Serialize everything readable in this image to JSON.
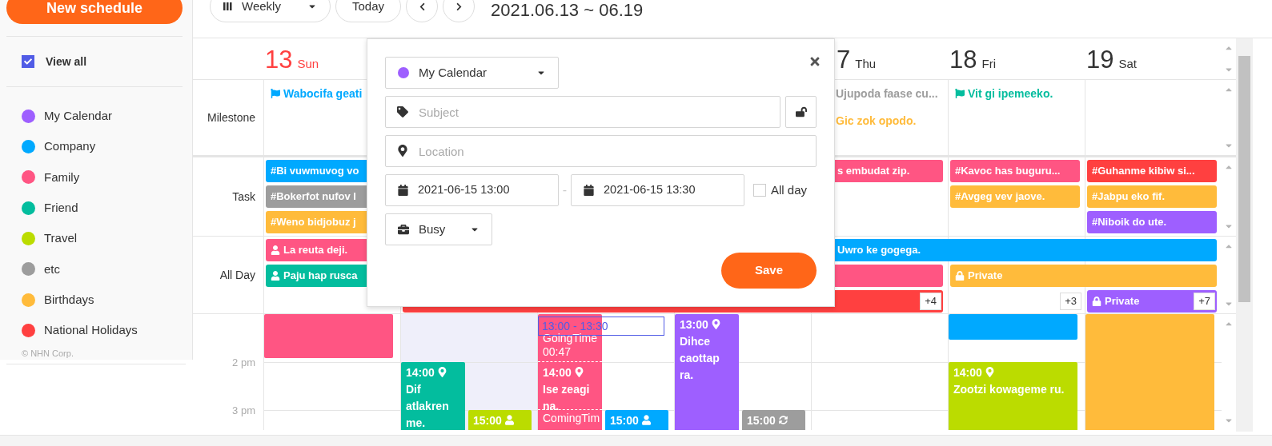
{
  "sidebar": {
    "new_button": "New schedule",
    "view_all": {
      "label": "View all",
      "checked": true
    },
    "calendars": [
      {
        "name": "My Calendar",
        "color": "#9e5fff"
      },
      {
        "name": "Company",
        "color": "#00a9ff"
      },
      {
        "name": "Family",
        "color": "#ff5583"
      },
      {
        "name": "Friend",
        "color": "#03bd9e"
      },
      {
        "name": "Travel",
        "color": "#bbdc00"
      },
      {
        "name": "etc",
        "color": "#9d9d9d"
      },
      {
        "name": "Birthdays",
        "color": "#ffbb3b"
      },
      {
        "name": "National Holidays",
        "color": "#ff4040"
      }
    ],
    "copyright": "© NHN Corp."
  },
  "toolbar": {
    "view": "Weekly",
    "today": "Today",
    "range": "2021.06.13 ~ 06.19"
  },
  "days": [
    {
      "date": "13",
      "weekday": "Sun",
      "holiday": true
    },
    {
      "date": "7",
      "weekday": "Thu",
      "holiday": false
    },
    {
      "date": "18",
      "weekday": "Fri",
      "holiday": false
    },
    {
      "date": "19",
      "weekday": "Sat",
      "holiday": false
    }
  ],
  "milestone": {
    "label": "Milestone",
    "cells": [
      {
        "items": [
          {
            "title": "Wabocifa geati",
            "color": "#00a9ff",
            "flag": true
          }
        ]
      },
      {
        "items": [
          {
            "title": "Ujupoda faase cu...",
            "color": "#9d9d9d",
            "flag": false
          },
          {
            "title": "Gic zok opodo.",
            "color": "#ffbb3b",
            "flag": false
          }
        ]
      },
      {
        "items": [
          {
            "title": "Vit gi ipemeeko.",
            "color": "#03bd9e",
            "flag": true
          }
        ]
      }
    ]
  },
  "task": {
    "label": "Task",
    "cells": [
      {
        "slots": [
          {
            "title": "#Bi vuwmuvog vo",
            "color": "#00a9ff"
          },
          {
            "title": "#Bokerfot nufov l",
            "color": "#9d9d9d"
          },
          {
            "title": "#Weno bidjobuz j",
            "color": "#ffbb3b"
          }
        ]
      },
      {
        "slots": [
          {
            "title": "s embudat zip.",
            "color": "#ff5583"
          }
        ]
      },
      {
        "slots": [
          {
            "title": "#Kavoc has buguru...",
            "color": "#ff5583"
          },
          {
            "title": "#Avgeg vev jaove.",
            "color": "#ffbb3b"
          }
        ]
      },
      {
        "slots": [
          {
            "title": "#Guhanme kibiw si...",
            "color": "#ff4040"
          },
          {
            "title": "#Jabpu eko fif.",
            "color": "#ffbb3b"
          },
          {
            "title": "#Niboik do ute.",
            "color": "#9e5fff"
          }
        ]
      }
    ]
  },
  "allday": {
    "label": "All Day",
    "cells": [
      {
        "slots": [
          {
            "kind": "person",
            "title": "La reuta deji.",
            "color": "#ff5583"
          },
          {
            "kind": "person",
            "title": "Paju hap rusca",
            "color": "#03bd9e"
          }
        ]
      },
      {
        "slots": [
          {
            "color": "#ff4040",
            "continues": true
          }
        ]
      },
      {
        "slots": [
          {
            "color": "#ff4040",
            "continues": true
          }
        ]
      },
      {
        "slots": [
          {
            "color": "#ff4040",
            "continues": true
          }
        ]
      },
      {
        "more": "+4",
        "slots": [
          {
            "title": "Uwro ke gogega.",
            "color": "#00a9ff",
            "continues": true
          },
          {
            "color": "#ff5583",
            "continues": false
          },
          {
            "color": "#ff4040",
            "continues": false
          }
        ]
      },
      {
        "more": "+3",
        "slots": [
          {
            "color": "#00a9ff",
            "continues": true
          },
          {
            "kind": "private",
            "title": "Private",
            "color": "#ffbb3b",
            "continues": true
          }
        ]
      },
      {
        "more": "+7",
        "slots": [
          {
            "color": "#00a9ff",
            "continues": false
          },
          {
            "color": "#ffbb3b",
            "continues": false
          },
          {
            "kind": "private",
            "title": "Private",
            "color": "#9e5fff",
            "continues": false
          }
        ]
      }
    ]
  },
  "time_labels": [
    "2 pm",
    "3 pm"
  ],
  "time_columns": [
    {
      "events": [
        {
          "kind": "plain",
          "color": "#ff5583"
        }
      ]
    },
    {
      "highlighted": true,
      "events": [
        {
          "kind": "location",
          "color": "#03bd9e",
          "time": "14:00",
          "title": "Dif atlakren me."
        },
        {
          "kind": "person",
          "color": "#bbdc00",
          "time": "15:00"
        }
      ]
    },
    {
      "events": [
        {
          "kind": "travel",
          "color": "#ff5583",
          "going": "GoingTime 00:47",
          "time": "14:00",
          "title": "Ise zeagi na.",
          "coming": "ComingTim"
        },
        {
          "kind": "person",
          "color": "#00a9ff",
          "time": "15:00"
        },
        {
          "kind": "selection",
          "label": "13:00 - 13:30"
        }
      ]
    },
    {
      "events": [
        {
          "kind": "location",
          "color": "#9e5fff",
          "time": "13:00",
          "title": "Dihce caottap ra."
        },
        {
          "kind": "repeat",
          "color": "#9d9d9d",
          "time": "15:00"
        }
      ]
    },
    {
      "events": [
        {
          "kind": "plain",
          "color": "#00a9ff"
        },
        {
          "kind": "location",
          "color": "#bbdc00",
          "time": "14:00",
          "title": "Zootzi kowageme ru."
        }
      ]
    },
    {
      "events": [
        {
          "kind": "plain",
          "color": "#ffbb3b"
        }
      ]
    }
  ],
  "popup": {
    "calendar": {
      "name": "My Calendar",
      "color": "#9e5fff"
    },
    "subject": {
      "placeholder": "Subject"
    },
    "locked": false,
    "location": {
      "placeholder": "Location"
    },
    "start": "2021-06-15 13:00",
    "separator": "-",
    "end": "2021-06-15 13:30",
    "all_day": {
      "label": "All day",
      "checked": false
    },
    "state": "Busy",
    "save": "Save"
  }
}
